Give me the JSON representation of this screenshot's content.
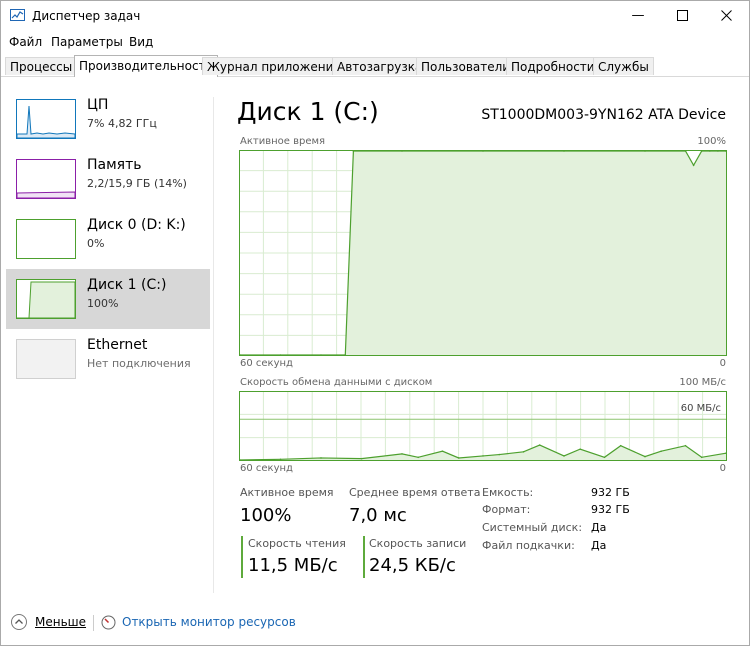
{
  "window": {
    "title": "Диспетчер задач"
  },
  "menu": [
    "Файл",
    "Параметры",
    "Вид"
  ],
  "tabs": [
    "Процессы",
    "Производительность",
    "Журнал приложений",
    "Автозагрузка",
    "Пользователи",
    "Подробности",
    "Службы"
  ],
  "active_tab": 1,
  "sidebar": [
    {
      "title": "ЦП",
      "sub": "7% 4,82 ГГц",
      "color": "#1177bb"
    },
    {
      "title": "Память",
      "sub": "2,2/15,9 ГБ (14%)",
      "color": "#8b1fa8"
    },
    {
      "title": "Диск 0 (D: K:)",
      "sub": "0%",
      "color": "#4da02e"
    },
    {
      "title": "Диск 1 (C:)",
      "sub": "100%",
      "color": "#4da02e"
    },
    {
      "title": "Ethernet",
      "sub": "Нет подключения",
      "color": "#bfbfbf"
    }
  ],
  "main": {
    "title": "Диск 1 (C:)",
    "device": "ST1000DM003-9YN162 ATA Device",
    "chart1": {
      "label": "Активное время",
      "max_label": "100%",
      "left_bottom": "60 секунд",
      "right_bottom": "0"
    },
    "chart2": {
      "label": "Скорость обмена данными с диском",
      "max_label": "100 МБ/с",
      "mid_label": "60 МБ/с",
      "left_bottom": "60 секунд",
      "right_bottom": "0"
    },
    "stats": {
      "active_label": "Активное время",
      "active_value": "100%",
      "resp_label": "Среднее время ответа",
      "resp_value": "7,0 мс",
      "read_label": "Скорость чтения",
      "read_value": "11,5 МБ/с",
      "write_label": "Скорость записи",
      "write_value": "24,5 КБ/с"
    },
    "info": [
      {
        "label": "Емкость:",
        "value": "932 ГБ"
      },
      {
        "label": "Формат:",
        "value": "932 ГБ"
      },
      {
        "label": "Системный диск:",
        "value": "Да"
      },
      {
        "label": "Файл подкачки:",
        "value": "Да"
      }
    ]
  },
  "footer": {
    "less": "Меньше",
    "monitor": "Открыть монитор ресурсов"
  },
  "chart_data": [
    {
      "type": "area",
      "title": "Активное время",
      "ylim": [
        0,
        100
      ],
      "x": [
        0,
        5,
        10,
        13,
        14,
        20,
        30,
        40,
        50,
        55,
        56,
        57,
        58,
        59,
        60
      ],
      "values": [
        0,
        0,
        0,
        0,
        100,
        100,
        100,
        100,
        100,
        100,
        93,
        100,
        100,
        100,
        100
      ],
      "grid": true,
      "color": "#4da02e"
    },
    {
      "type": "area",
      "title": "Скорость обмена данными с диском",
      "ylim": [
        0,
        100
      ],
      "x": [
        0,
        5,
        10,
        15,
        20,
        22,
        25,
        27,
        30,
        32,
        35,
        37,
        40,
        42,
        45,
        47,
        50,
        52,
        55,
        57,
        60
      ],
      "values": [
        0,
        1,
        3,
        2,
        9,
        4,
        13,
        3,
        6,
        8,
        12,
        22,
        6,
        16,
        4,
        21,
        5,
        13,
        21,
        4,
        10
      ],
      "grid": true,
      "color": "#4da02e"
    }
  ]
}
